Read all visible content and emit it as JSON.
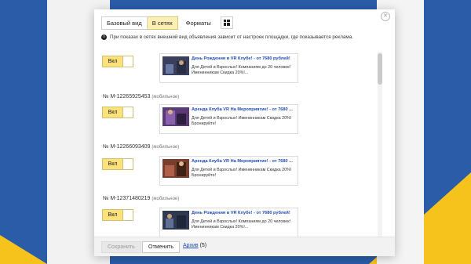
{
  "tabs": [
    {
      "label": "Базовый вид"
    },
    {
      "label": "В сетях"
    },
    {
      "label": "Форматы"
    }
  ],
  "info_text": "При показах в сетях внешний вид объявления зависит от настроек площадки, где показывается реклама.",
  "toggle_label": "Вкл",
  "items": [
    {
      "id_text": "",
      "id_sub": "",
      "title": "День Рождения в VR Клубе! - от 7680 рублей!",
      "body": "Для Детей и Взрослых! Компаниям до 20 человек! Именинникам Скидка 20%!..."
    },
    {
      "id_text": "№ M-12265925453",
      "id_sub": "(мобильное)",
      "title": "Аренда Клуба VR На Мероприятие! - от 7680 ...",
      "body": "Для Детей и Взрослых! Именинникам Скидка 20%! Бронируйте!"
    },
    {
      "id_text": "№ M-12266093409",
      "id_sub": "(мобильное)",
      "title": "Аренда Клуба VR На Мероприятие! - от 7680 ...",
      "body": "Для Детей и Взрослых! Именинникам Скидка 20%! Бронируйте!"
    },
    {
      "id_text": "№ M-12371480219",
      "id_sub": "(мобильное)",
      "title": "День Рождения в VR Клубе! - от 7680 рублей!",
      "body": "Для Детей и Взрослых! Компаниям до 20 человек! Именинникам Скидка 20%!..."
    }
  ],
  "footer": {
    "save_label": "Сохранить",
    "cancel_label": "Отменить",
    "archive_label": "Архив",
    "archive_count": "(5)"
  },
  "colors": {
    "background_blue": "#2a5ca8",
    "accent_yellow": "#fde17a",
    "link_blue": "#1f4db7"
  }
}
